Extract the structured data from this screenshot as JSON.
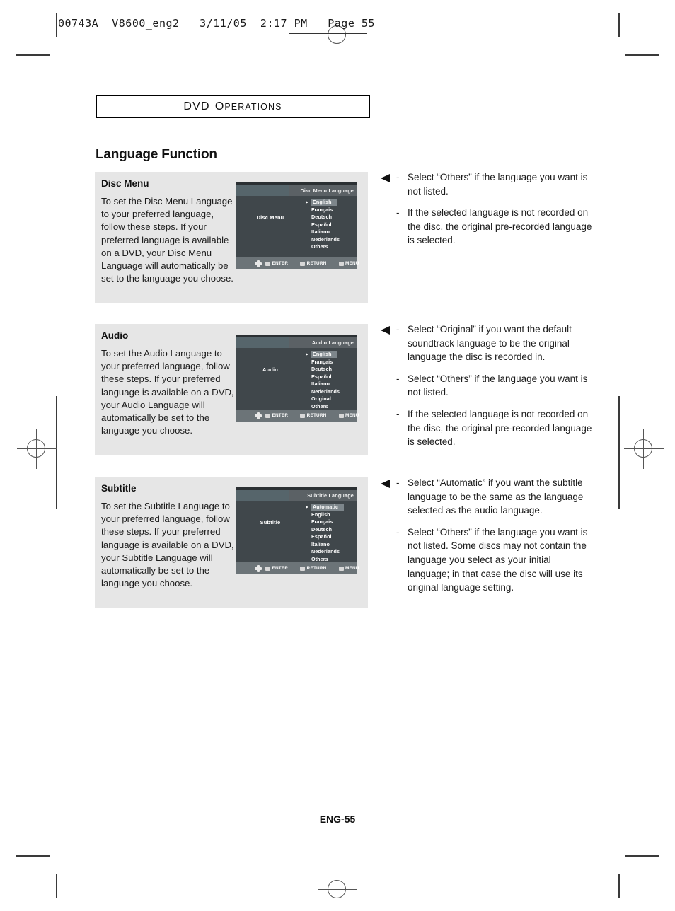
{
  "prepress": {
    "slug": "00743A  V8600_eng2   3/11/05  2:17 PM   Page 55"
  },
  "section_header": {
    "lead": "DVD",
    "rest": "Operations"
  },
  "page_title": "Language Function",
  "footer": "ENG-55",
  "blocks": [
    {
      "title": "Disc Menu",
      "body": "To set the Disc Menu Language to your preferred language, follow these steps. If your preferred language is available on a DVD, your Disc Menu Language will automatically be set to the language you choose.",
      "osd": {
        "title": "Disc Menu Language",
        "side_label": "Disc Menu",
        "items": [
          "English",
          "Français",
          "Deutsch",
          "Español",
          "Italiano",
          "Nederlands",
          "Others"
        ],
        "selected": "English",
        "keys": [
          "ENTER",
          "RETURN",
          "MENU"
        ],
        "dpad_icon": "dpad-icon"
      },
      "notes": [
        "Select “Others” if the language you want is not listed.",
        "If the selected language is not recorded on the disc, the original pre-recorded language is selected."
      ]
    },
    {
      "title": "Audio",
      "body": "To set the Audio Language to your preferred language, follow these steps. If your preferred language is available on a DVD, your Audio Language will automatically be set to the language you choose.",
      "osd": {
        "title": "Audio Language",
        "side_label": "Audio",
        "items": [
          "English",
          "Français",
          "Deutsch",
          "Español",
          "Italiano",
          "Nederlands",
          "Original",
          "Others"
        ],
        "selected": "English",
        "keys": [
          "ENTER",
          "RETURN",
          "MENU"
        ],
        "dpad_icon": "dpad-icon"
      },
      "notes": [
        "Select “Original” if you want the default soundtrack language to be the original language the disc is recorded in.",
        "Select “Others” if the language you want is not listed.",
        "If the selected language is not recorded on the disc, the original pre-recorded language is selected."
      ]
    },
    {
      "title": "Subtitle",
      "body": "To set the Subtitle Language to your preferred language, follow these steps. If your preferred language is available on a DVD, your Subtitle Language will automatically be set to the language you choose.",
      "osd": {
        "title": "Subtitle Language",
        "side_label": "Subtitle",
        "items": [
          "Automatic",
          "English",
          "Français",
          "Deutsch",
          "Español",
          "Italiano",
          "Nederlands",
          "Others"
        ],
        "selected": "Automatic",
        "keys": [
          "ENTER",
          "RETURN",
          "MENU"
        ],
        "dpad_icon": "dpad-icon"
      },
      "notes": [
        "Select “Automatic” if you want the subtitle language to be the same as the language selected as the audio language.",
        "Select “Others” if the language you want is not listed. Some discs may not contain the language you select as your initial language; in that case the disc will use its original language setting."
      ]
    }
  ],
  "bullet_dash": "-",
  "colors": {
    "panel_gray": "#e6e6e6",
    "osd_body": "#40474b",
    "osd_titlebar": "#5b6165",
    "osd_titlebar_left": "#56656b",
    "osd_bottombar": "#6c7478",
    "osd_highlight": "#7d868b"
  }
}
